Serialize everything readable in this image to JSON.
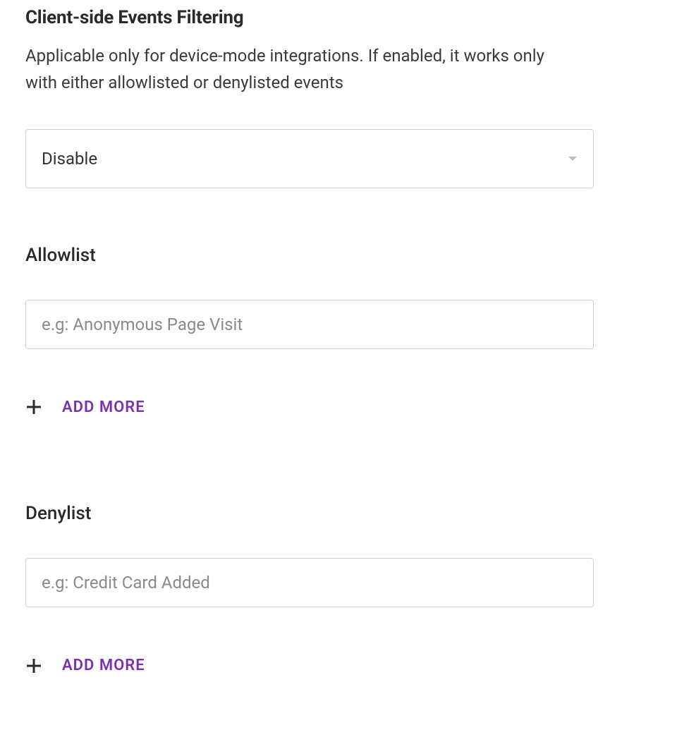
{
  "header": {
    "title": "Client-side Events Filtering",
    "description": "Applicable only for device-mode integrations. If enabled, it works only with either allowlisted or denylisted events"
  },
  "filterMode": {
    "selected": "Disable"
  },
  "allowlist": {
    "title": "Allowlist",
    "input_value": "",
    "placeholder": "e.g: Anonymous Page Visit",
    "add_more_label": "ADD MORE"
  },
  "denylist": {
    "title": "Denylist",
    "input_value": "",
    "placeholder": "e.g: Credit Card Added",
    "add_more_label": "ADD MORE"
  },
  "colors": {
    "accent": "#7a2fb5",
    "text": "#2a2a2a",
    "muted": "#8a8a8a",
    "border": "#d0d0d0"
  }
}
